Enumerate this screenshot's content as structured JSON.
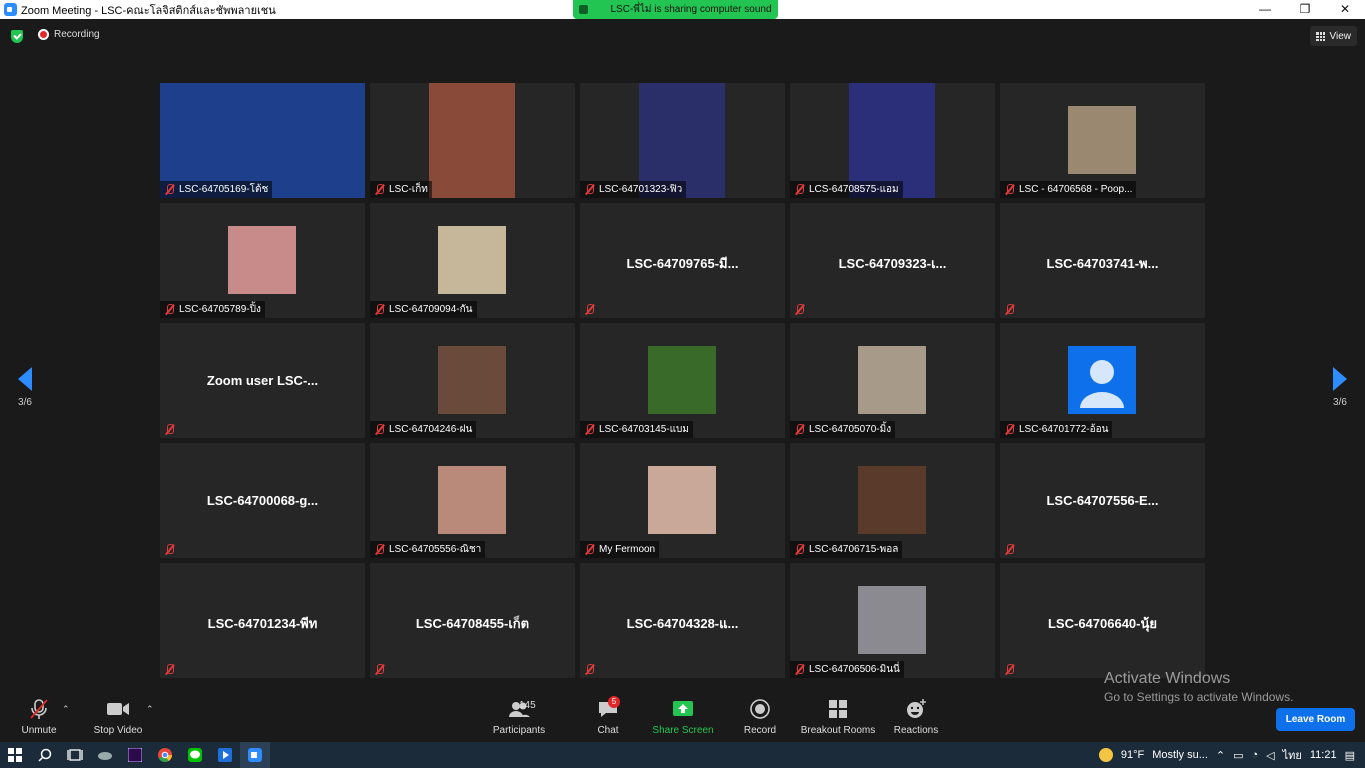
{
  "window": {
    "title": "Zoom Meeting - LSC-คณะโลจิสติกส์และชัพพลายเชน",
    "controls": [
      "—",
      "❐",
      "✕"
    ]
  },
  "share_banner": "LSC-พี่ไม่ is sharing computer sound",
  "topbar": {
    "recording_label": "Recording",
    "view_label": "View"
  },
  "pagination": {
    "left": "3/6",
    "right": "3/6"
  },
  "tiles": [
    {
      "name": "LSC-64705169-โต้ช",
      "type": "video",
      "color": "#1d3f8c"
    },
    {
      "name": "LSC-เก็ท",
      "type": "video",
      "color": "#8a4a3a"
    },
    {
      "name": "LSC-64701323-ฟิว",
      "type": "video",
      "color": "#2a2f6a"
    },
    {
      "name": "LCS-64708575-แอม",
      "type": "video",
      "color": "#2b2f7a"
    },
    {
      "name": "LSC - 64706568 - Poop...",
      "type": "avatar",
      "color": "#9a8870"
    },
    {
      "name": "LSC-64705789-ปิ้ง",
      "type": "avatar",
      "color": "#c98a8a"
    },
    {
      "name": "LSC-64709094-กัน",
      "type": "avatar",
      "color": "#c7b79a"
    },
    {
      "name": "LSC-64709765-มี...",
      "type": "text"
    },
    {
      "name": "LSC-64709323-เ...",
      "type": "text"
    },
    {
      "name": "LSC-64703741-พ...",
      "type": "text"
    },
    {
      "name": "Zoom user LSC-...",
      "type": "text"
    },
    {
      "name": "LSC-64704246-ฝน",
      "type": "avatar",
      "color": "#6a4a3a"
    },
    {
      "name": "LSC-64703145-แบม",
      "type": "avatar",
      "color": "#3a6a2a"
    },
    {
      "name": "LSC-64705070-มิ้ง",
      "type": "avatar",
      "color": "#a89a88"
    },
    {
      "name": "LSC-64701772-อ้อน",
      "type": "default",
      "color": "#0e71eb"
    },
    {
      "name": "LSC-64700068-g...",
      "type": "text"
    },
    {
      "name": "LSC-64705556-ณิชา",
      "type": "avatar",
      "color": "#b9897a"
    },
    {
      "name": "My Fermoon",
      "type": "avatar",
      "color": "#c9a89a"
    },
    {
      "name": "LSC-64706715-พอล",
      "type": "avatar",
      "color": "#5a3a2a"
    },
    {
      "name": "LSC-64707556-E...",
      "type": "text"
    },
    {
      "name": "LSC-64701234-พีท",
      "type": "text"
    },
    {
      "name": "LSC-64708455-เก็ต",
      "type": "text"
    },
    {
      "name": "LSC-64704328-แ...",
      "type": "text"
    },
    {
      "name": "LSC-64706506-มินนี่",
      "type": "avatar",
      "color": "#8a8a90"
    },
    {
      "name": "LSC-64706640-นุ้ย",
      "type": "text"
    }
  ],
  "toolbar": {
    "unmute": "Unmute",
    "stop_video": "Stop Video",
    "participants": "Participants",
    "participants_count": "145",
    "chat": "Chat",
    "chat_badge": "5",
    "share_screen": "Share Screen",
    "record": "Record",
    "breakout_rooms": "Breakout Rooms",
    "reactions": "Reactions",
    "leave_room": "Leave Room"
  },
  "watermark": {
    "line1": "Activate Windows",
    "line2": "Go to Settings to activate Windows."
  },
  "taskbar": {
    "weather": "91°F",
    "weather_desc": "Mostly su...",
    "lang": "ไทย",
    "time": "11:21"
  }
}
